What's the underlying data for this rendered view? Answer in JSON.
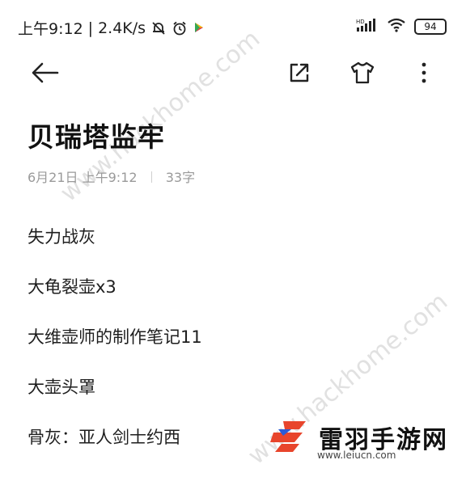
{
  "status_bar": {
    "time": "上午9:12",
    "separator": "|",
    "speed": "2.4K/s",
    "battery": "94",
    "icons": [
      "mute-bell-icon",
      "alarm-icon",
      "play-store-icon",
      "hd-signal-icon",
      "wifi-icon",
      "battery-icon"
    ]
  },
  "toolbar": {
    "icons": [
      "back-arrow-icon",
      "share-icon",
      "theme-shirt-icon",
      "more-vertical-icon"
    ]
  },
  "note": {
    "title": "贝瑞塔监牢",
    "date": "6月21日 上午9:12",
    "char_count": "33字",
    "lines": [
      "失力战灰",
      "大龟裂壶x3",
      "大维壶师的制作笔记11",
      "大壶头罩",
      "骨灰：亚人剑士约西"
    ]
  },
  "watermark": {
    "top": "www.hackhome.com",
    "bottom": "www.hackhome.com",
    "small": "hackhome"
  },
  "logo": {
    "text": "雷羽手游网",
    "url": "www.leiucn.com",
    "accent_color": "#e8452c"
  }
}
